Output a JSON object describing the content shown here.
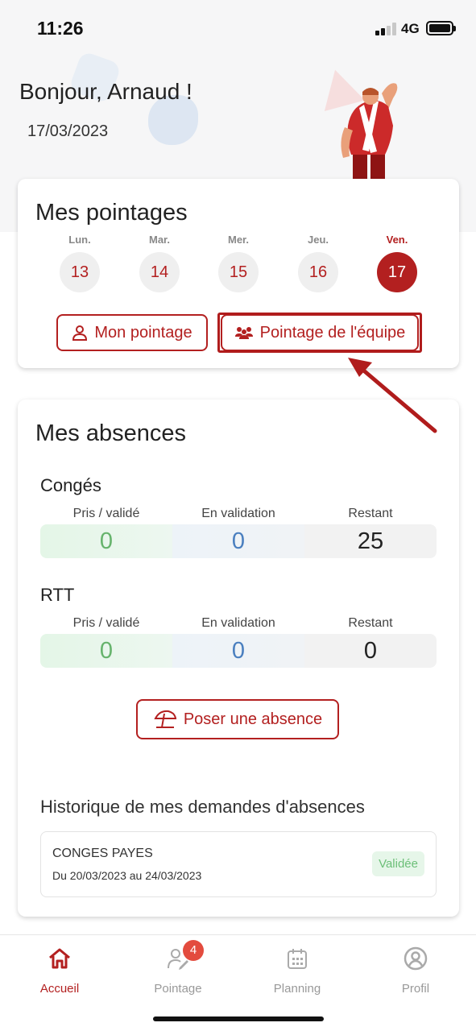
{
  "status_bar": {
    "time": "11:26",
    "network": "4G"
  },
  "header": {
    "greeting": "Bonjour, Arnaud !",
    "date": "17/03/2023"
  },
  "pointages": {
    "title": "Mes pointages",
    "days": [
      {
        "label": "Lun.",
        "num": "13",
        "active": false
      },
      {
        "label": "Mar.",
        "num": "14",
        "active": false
      },
      {
        "label": "Mer.",
        "num": "15",
        "active": false
      },
      {
        "label": "Jeu.",
        "num": "16",
        "active": false
      },
      {
        "label": "Ven.",
        "num": "17",
        "active": true
      }
    ],
    "mon_pointage_label": "Mon pointage",
    "equipe_label": "Pointage de l'équipe"
  },
  "absences": {
    "title": "Mes absences",
    "conges": {
      "label": "Congés",
      "headers": [
        "Pris / validé",
        "En validation",
        "Restant"
      ],
      "values": [
        "0",
        "0",
        "25"
      ]
    },
    "rtt": {
      "label": "RTT",
      "headers": [
        "Pris / validé",
        "En validation",
        "Restant"
      ],
      "values": [
        "0",
        "0",
        "0"
      ]
    },
    "poser_label": "Poser une absence",
    "history_title": "Historique de mes demandes d'absences",
    "history": [
      {
        "type": "CONGES PAYES",
        "dates": "Du 20/03/2023 au 24/03/2023",
        "status": "Validée"
      }
    ]
  },
  "nav": {
    "items": [
      {
        "label": "Accueil",
        "active": true,
        "icon": "home-icon"
      },
      {
        "label": "Pointage",
        "active": false,
        "icon": "user-edit-icon",
        "badge": "4"
      },
      {
        "label": "Planning",
        "active": false,
        "icon": "calendar-icon"
      },
      {
        "label": "Profil",
        "active": false,
        "icon": "profile-icon"
      }
    ]
  },
  "colors": {
    "accent": "#b32020",
    "green": "#66b36c",
    "blue": "#4a7fbf"
  }
}
